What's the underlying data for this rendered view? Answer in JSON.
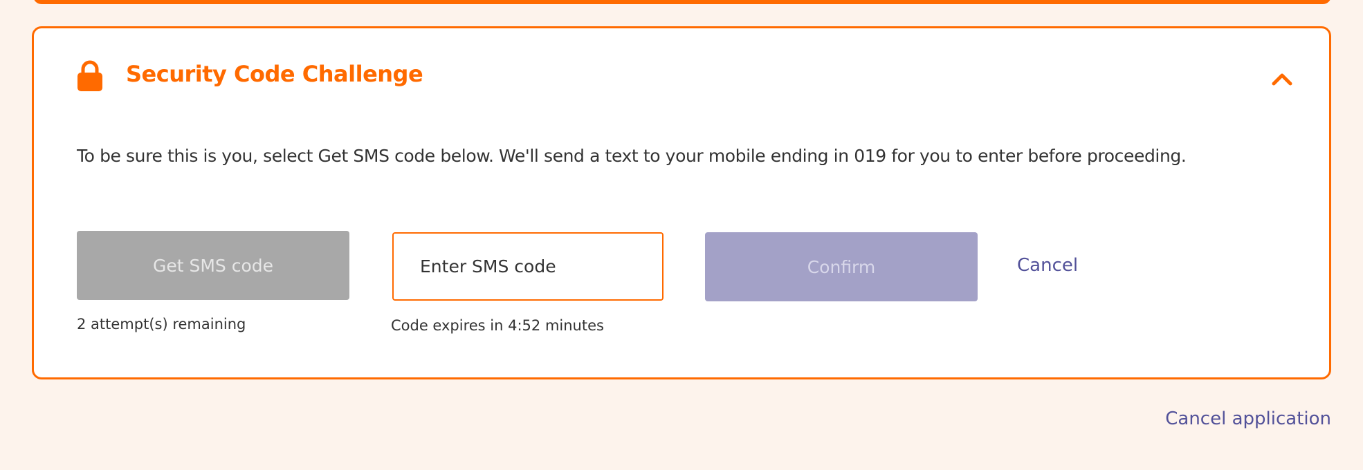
{
  "challenge": {
    "title": "Security Code Challenge",
    "description": "To be sure this is you, select Get SMS code below. We'll send a text to your mobile ending in 019 for you to enter before proceeding.",
    "get_sms_label": "Get SMS code",
    "attempts_text": "2 attempt(s) remaining",
    "sms_input_placeholder": "Enter SMS code",
    "sms_input_value": "",
    "expires_text": "Code expires in 4:52 minutes",
    "confirm_label": "Confirm",
    "cancel_label": "Cancel"
  },
  "footer": {
    "cancel_application_label": "Cancel application"
  },
  "icons": {
    "header": "lock-icon",
    "collapse": "chevron-up-icon"
  },
  "colors": {
    "accent": "#ff6a00",
    "link": "#525199",
    "disabled_gray": "#a8a8a8",
    "disabled_confirm": "#a3a1c7",
    "page_background": "#fdf3ec"
  }
}
